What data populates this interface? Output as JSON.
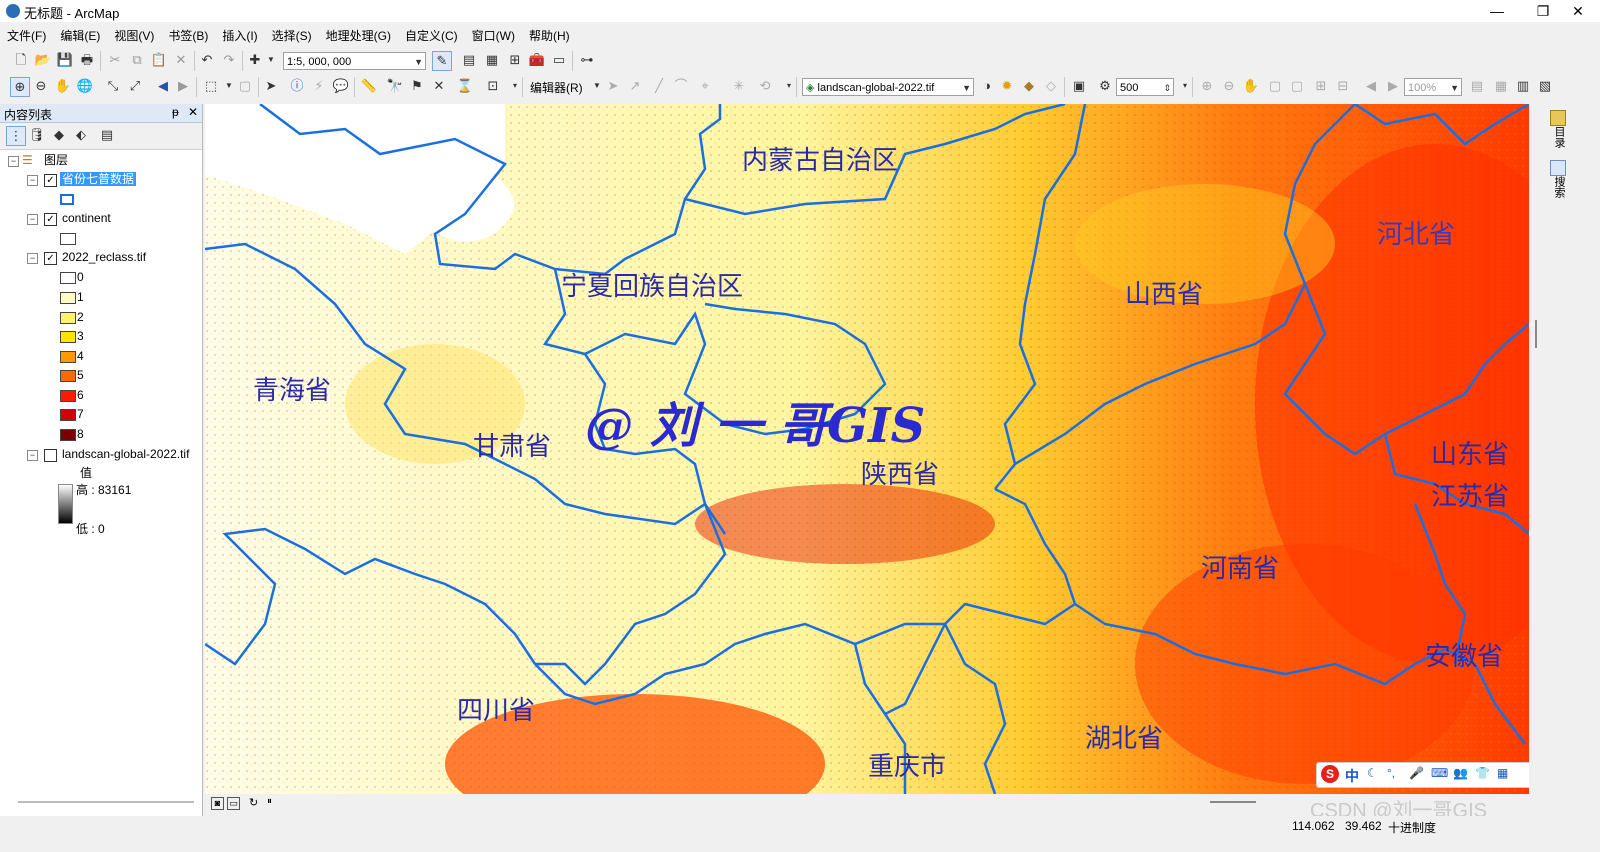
{
  "window": {
    "title": "无标题 - ArcMap",
    "controls": [
      "—",
      "❐",
      "✕"
    ]
  },
  "menu": [
    "文件(F)",
    "编辑(E)",
    "视图(V)",
    "书签(B)",
    "插入(I)",
    "选择(S)",
    "地理处理(G)",
    "自定义(C)",
    "窗口(W)",
    "帮助(H)"
  ],
  "toolbar": {
    "scale": "1:5, 000, 000",
    "editor_label": "编辑器(R)",
    "layer_combo": "landscan-global-2022.tif",
    "value_field": "500",
    "zoom_combo": "100%"
  },
  "toc": {
    "title": "内容列表",
    "pin": "ᵽ",
    "close": "✕",
    "root_label": "图层",
    "layers": [
      {
        "name": "省份七普数据",
        "checked": true
      },
      {
        "name": "continent",
        "checked": true
      },
      {
        "name": "2022_reclass.tif",
        "checked": true
      },
      {
        "name": "landscan-global-2022.tif",
        "checked": false
      }
    ],
    "classes": [
      {
        "label": "0",
        "color": "#ffffff"
      },
      {
        "label": "1",
        "color": "#fffbc4"
      },
      {
        "label": "2",
        "color": "#fff36a"
      },
      {
        "label": "3",
        "color": "#ffe400"
      },
      {
        "label": "4",
        "color": "#ff9a00"
      },
      {
        "label": "5",
        "color": "#ff6a00"
      },
      {
        "label": "6",
        "color": "#ff1a00"
      },
      {
        "label": "7",
        "color": "#d40000"
      },
      {
        "label": "8",
        "color": "#7a0000"
      }
    ],
    "value_header": "值",
    "high_label": "高 : 83161",
    "low_label": "低 : 0"
  },
  "map": {
    "labels": {
      "neimenggu": "内蒙古自治区",
      "ningxia": "宁夏回族自治区",
      "shanxi": "山西省",
      "hebei": "河北省",
      "qinghai": "青海省",
      "gansu": "甘肃省",
      "shaanxi": "陕西省",
      "shandong": "山东省",
      "jiangsu": "江苏省",
      "henan": "河南省",
      "anhui": "安徽省",
      "sichuan": "四川省",
      "hubei": "湖北省",
      "chongqing": "重庆市"
    },
    "overlay_text": "@ 刘 一 哥GIS",
    "boundary_color": "#1a6fe0"
  },
  "right_strip": [
    "目录",
    "搜索"
  ],
  "ime_text": "中",
  "watermark": "CSDN @刘一哥GIS",
  "status": {
    "x": "114.062",
    "y": "39.462",
    "units": "十进制度"
  }
}
